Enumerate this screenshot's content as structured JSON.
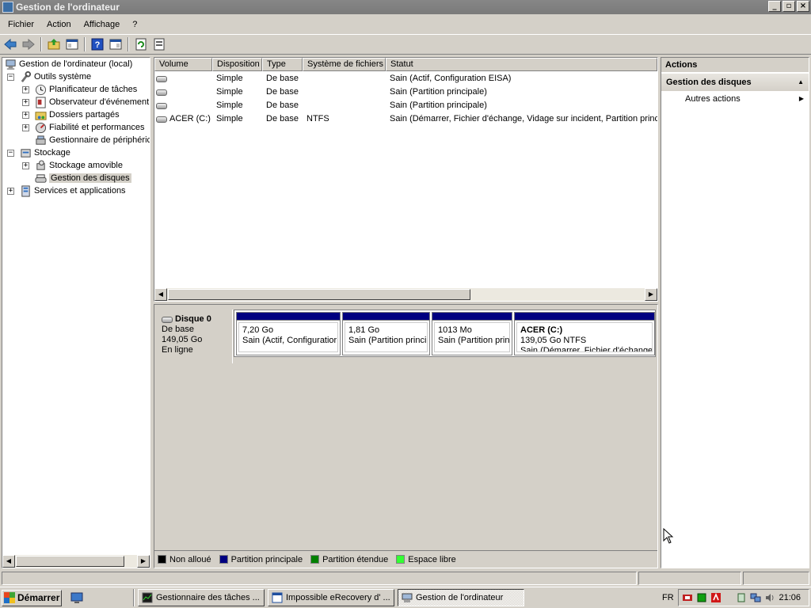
{
  "window": {
    "title": "Gestion de l'ordinateur"
  },
  "window_controls": {
    "minimize": "_",
    "maximize": "▫",
    "close": "×"
  },
  "menu": [
    "Fichier",
    "Action",
    "Affichage",
    "?"
  ],
  "toolbar_icons": [
    "back-arrow-icon",
    "forward-arrow-icon",
    "up-folder-icon",
    "show-hide-tree-icon",
    "help-icon",
    "properties-icon",
    "refresh-icon",
    "export-icon"
  ],
  "tree": {
    "root": "Gestion de l'ordinateur (local)",
    "system_tools": "Outils système",
    "task_scheduler": "Planificateur de tâches",
    "event_viewer": "Observateur d'événement",
    "shared_folders": "Dossiers partagés",
    "reliability": "Fiabilité et performances",
    "device_manager": "Gestionnaire de périphéric",
    "storage": "Stockage",
    "removable_storage": "Stockage amovible",
    "disk_management": "Gestion des disques",
    "services": "Services et applications"
  },
  "volumes": {
    "columns": [
      "Volume",
      "Disposition",
      "Type",
      "Système de fichiers",
      "Statut"
    ],
    "rows": [
      {
        "volume": "",
        "layout": "Simple",
        "type": "De base",
        "fs": "",
        "status": "Sain (Actif, Configuration EISA)"
      },
      {
        "volume": "",
        "layout": "Simple",
        "type": "De base",
        "fs": "",
        "status": "Sain (Partition principale)"
      },
      {
        "volume": "",
        "layout": "Simple",
        "type": "De base",
        "fs": "",
        "status": "Sain (Partition principale)"
      },
      {
        "volume": "ACER (C:)",
        "layout": "Simple",
        "type": "De base",
        "fs": "NTFS",
        "status": "Sain (Démarrer, Fichier d'échange, Vidage sur incident, Partition princip"
      }
    ]
  },
  "disk": {
    "name": "Disque 0",
    "type": "De base",
    "size": "149,05 Go",
    "state": "En ligne",
    "partitions": [
      {
        "name": "",
        "size": "7,20 Go",
        "status": "Sain (Actif, Configuratior"
      },
      {
        "name": "",
        "size": "1,81 Go",
        "status": "Sain (Partition princip"
      },
      {
        "name": "",
        "size": "1013 Mo",
        "status": "Sain (Partition prin"
      },
      {
        "name": "ACER  (C:)",
        "size": "139,05 Go NTFS",
        "status": "Sain (Démarrer, Fichier d'échange,"
      }
    ]
  },
  "legend": [
    {
      "label": "Non alloué",
      "color": "#000000"
    },
    {
      "label": "Partition principale",
      "color": "#000080"
    },
    {
      "label": "Partition étendue",
      "color": "#008000"
    },
    {
      "label": "Espace libre",
      "color": "#33ff33"
    }
  ],
  "actions": {
    "header": "Actions",
    "section": "Gestion des disques",
    "more": "Autres actions"
  },
  "taskbar": {
    "start": "Démarrer",
    "tasks": [
      {
        "label": "Gestionnaire des tâches ...",
        "active": false
      },
      {
        "label": "Impossible eRecovery d' ...",
        "active": false
      },
      {
        "label": "Gestion de l'ordinateur",
        "active": true
      }
    ],
    "language": "FR",
    "clock": "21:06"
  }
}
